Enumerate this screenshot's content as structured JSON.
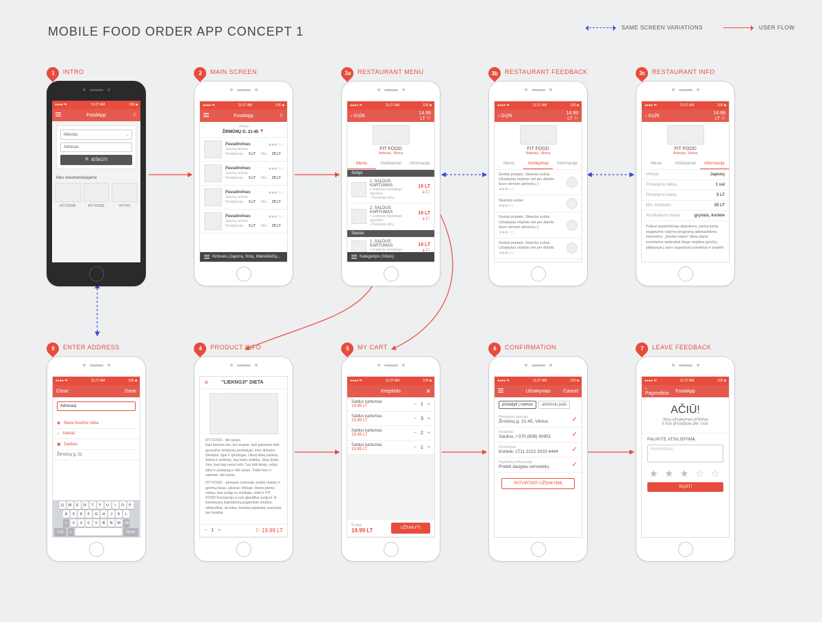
{
  "page_title": "MOBILE FOOD ORDER APP CONCEPT 1",
  "legend": {
    "variation": "SAME SCREEN VARIATIONS",
    "flow": "USER FLOW"
  },
  "statusbar": {
    "left": "●●●●  ⇆",
    "time": "11:27 AM",
    "right": "100 ■"
  },
  "app_name": "FoodApp",
  "screens": {
    "s1": {
      "pin": "1",
      "label": "INTRO",
      "city_label": "Miestas",
      "addr_label": "Adresas",
      "search": "IEŠKOTI",
      "recommend": "Mes rekomenduojame",
      "thumbs": [
        "FIT FOOD",
        "FIT FOOD",
        "FIT FO"
      ]
    },
    "s2": {
      "pin": "2",
      "label": "MAIN SCREEN",
      "location_city": "Vilnius",
      "location": "ŽIRMŪNŲ G. 21-45",
      "items": [
        {
          "name": "Pavadinimas",
          "sub": "Juponų virtuvė",
          "deliv": "Pristatymas",
          "deliv_v": "5 LT",
          "min": "Min",
          "min_v": "25 LT"
        },
        {
          "name": "Pavadinimas",
          "sub": "Juponų virtuvė",
          "deliv": "Pristatymas",
          "deliv_v": "5 LT",
          "min": "Min",
          "min_v": "25 LT"
        },
        {
          "name": "Pavadinimas",
          "sub": "Juponų virtuvė",
          "deliv": "Pristatymas",
          "deliv_v": "5 LT",
          "min": "Min",
          "min_v": "25 LT"
        },
        {
          "name": "Pavadinimas",
          "sub": "Juponų virtuvė",
          "deliv": "Pristatymas",
          "deliv_v": "5 LT",
          "min": "Min",
          "min_v": "25 LT"
        }
      ],
      "filter": "Kirtuvės (Japonų, Kinų, Meksikiečių..."
    },
    "s3a": {
      "pin": "3a",
      "label": "RESTAURANT MENU",
      "back": "Grįžti",
      "total": "14.99 LT",
      "rest": "FIT FOOD",
      "rest_sub": "Adresas, Vilnius",
      "tabs": [
        "Meniu",
        "Atsiliepimai",
        "Informacija"
      ],
      "cat1": "Sultys",
      "items": [
        {
          "n": "1. SALDUS KARTUMAS",
          "d": "• Grietinės mėsiškojo apysūrio\n• Pusserija sōrų",
          "p": "19 LT"
        },
        {
          "n": "2. SALDUS KARTUMAS",
          "d": "• Grietinės mėsiškojo apysūrio\n• Pusserija sōrų",
          "p": "19 LT"
        }
      ],
      "cat2": "Sanosi",
      "items2": [
        {
          "n": "1. SALDUS KARTUMAS",
          "d": "• Grietinės mėsiškojo apysūrio",
          "p": "19 LT"
        }
      ],
      "filter": "Kategorijos (Visos)"
    },
    "s3b": {
      "pin": "3b",
      "label": "RESTAURANT FEEDBACK",
      "back": "Grįžti",
      "total": "14.99 LT",
      "rest": "FIT FOOD",
      "rest_sub": "Adresas, Vilnius",
      "tabs": [
        "Meniu",
        "Atsiliepimai",
        "Informacija"
      ],
      "reviews": [
        {
          "t": "Greitai pristatė. Skaniūs sušiai. Užsakytas mlyksis net per didelis buvo vienam ašmenių ;)"
        },
        {
          "t": "Skaniūs sušiai."
        },
        {
          "t": "Greitai pristatė. Skaniūs sušiai. Užsakytas mlyksis net per didelis buvo vienam ašmenių ;)"
        },
        {
          "t": "Greitai pristatė. Skaniūs sušiai. Užsakytas mlyksis net per didelis"
        }
      ]
    },
    "s3c": {
      "pin": "3c",
      "label": "RESTAURANT INFO",
      "back": "Grįžti",
      "total": "14.99 LT",
      "rest": "FIT FOOD",
      "rest_sub": "Adresas, Vilnius",
      "tabs": [
        "Meniu",
        "Atsiliepimai",
        "Informacija"
      ],
      "rows": [
        {
          "k": "Virtuvė",
          "v": "Japonų"
        },
        {
          "k": "Pristatymo laikas",
          "v": "1 val"
        },
        {
          "k": "Pristatymo kaina",
          "v": "5 LT"
        },
        {
          "k": "Min. krepšelis",
          "v": "25 LT"
        },
        {
          "k": "Atsiskaitymo būdai",
          "v": "grynais, kortele"
        }
      ],
      "desc": "Puikus pasirinkimas aktyviems, pirmą kartą organizmo valymo programą atliekantiems žmonėms. „Sveiko starto\" dieta skirta norintiems atsikratyti blogo mitybos įpročių, įsiklausyti į savo organizmo poreikius ir pradėti"
    },
    "s4": {
      "pin": "4",
      "label": "PRODUCT INFO",
      "close": "✕",
      "title": "\"LIEKNOJI\" DIETA",
      "p1": "FIT FOOD - dėl savęs.\nKad būtume ten, kur esame, kad galėtume būti gyvenimo lenktynių priešakyje, mes dirbame žtempiai, ilgai ir tykstingai. Likusį laiką pašimą šeima ir artimieji, šau beko nelieka. Jūsų širdis žino, kad taip neturi būti. Turi būti kitaip, reikia laiko ir pastangų ir dėl savęs. Todėl mes ir sakome: dėl savęs.",
      "p2": "FIT FOOD – pirmasis Lietuvoje sveiko maisto ir gėrimų baras, įsikūręs Vilniuje. Mums įdomu viskas, kas susiję su sveikata, todėl ir FIT FOOD koncepcija su tuo glaudžiai susijusi: iš šviežiausių ingredientų pagaminto sriubos, užkandžiai, sa-lotos, konštai patekalai, pusryčiai bei šviežiai",
      "qty": "1",
      "price": "19.99 LT"
    },
    "s5": {
      "pin": "5",
      "label": "MY CART",
      "title": "Krepšelis",
      "close": "✕",
      "items": [
        {
          "n": "Saldus kartumas",
          "p": "19.99 LT",
          "q": "1"
        },
        {
          "n": "Saldus kartumas",
          "p": "19.99 LT",
          "q": "3"
        },
        {
          "n": "Saldus kartumas",
          "p": "19.99 LT",
          "q": "2"
        },
        {
          "n": "Saldus kartumas",
          "p": "19.99 LT",
          "q": "1"
        }
      ],
      "total_label": "Iš viso:",
      "total": "19.99 LT",
      "order": "UŽSAKYTI"
    },
    "s6": {
      "pin": "6",
      "label": "CONFIRMATION",
      "title": "Užsakymas",
      "cancel": "Cancel",
      "toggle": [
        "pristatyti į namus",
        "atsiimsiu pats"
      ],
      "rows": [
        {
          "k": "Pristatymo adresas",
          "v": "Žirmūnų g. 21-45, Vilnius"
        },
        {
          "k": "Kontaktai",
          "v": "Saulius, +370 (636) 90951"
        },
        {
          "k": "Kortelė/pns",
          "v": "Kortelė, LT11 2222 3333 4444"
        },
        {
          "k": "Papildoma informacija",
          "v": "Pridėti daugiau servetėlių"
        }
      ],
      "confirm": "PATVIRTINTI UŽSAKYMĄ"
    },
    "s7": {
      "pin": "7",
      "label": "LEAVE FEEDBACK",
      "back": "Pagrindinis",
      "title": "FoodApp",
      "thanks": "AČIŪ!",
      "sub": "Jūsų užsakymas priimtas\nir bus pristatytas per 1val.",
      "leave": "PALIKITE ATSILIEPIMĄ",
      "comment": "Komentaras",
      "send": "SIŲSTI"
    },
    "s9": {
      "pin": "9",
      "label": "ENTER ADDRESS",
      "close": "Close",
      "done": "Done",
      "input": "Adresas|",
      "opts": [
        "Mano buvimo vieta",
        "Namai",
        "Darbas"
      ],
      "sugg": "Žirmūnų g. 21",
      "k1": "QWERTYUIOP",
      "k2": "ASDFGHJKL",
      "k3": "ZXCVBNM"
    }
  }
}
